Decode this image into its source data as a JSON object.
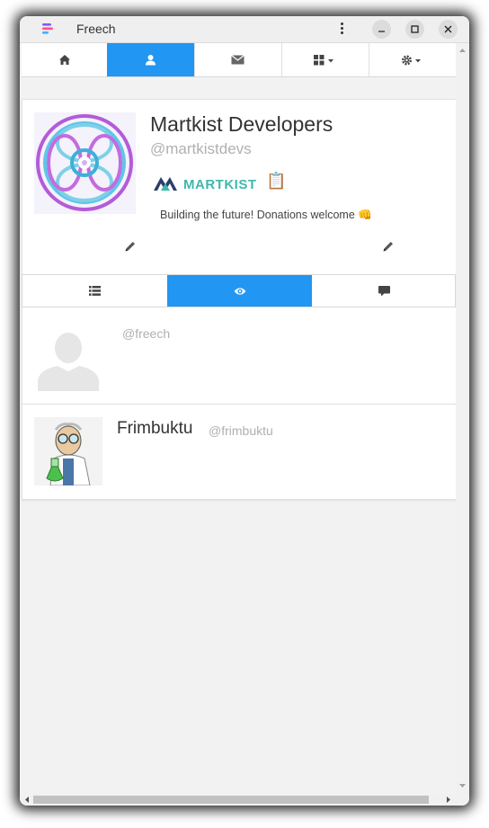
{
  "window": {
    "title": "Freech",
    "app_icon": "freech-logo-icon"
  },
  "navbar": {
    "tabs": [
      {
        "icon": "home-icon",
        "active": false
      },
      {
        "icon": "user-icon",
        "active": true
      },
      {
        "icon": "envelope-icon",
        "active": false
      },
      {
        "icon": "grid-dropdown-icon",
        "active": false
      },
      {
        "icon": "gear-dropdown-icon",
        "active": false
      }
    ]
  },
  "profile": {
    "name": "Martkist Developers",
    "handle": "@martkistdevs",
    "brand_text": "MARTKIST",
    "clipboard_glyph": "📋",
    "bio": "Building the future! Donations welcome 👊"
  },
  "profile_tabs": [
    {
      "icon": "list-icon",
      "active": false
    },
    {
      "icon": "eye-icon",
      "active": true
    },
    {
      "icon": "comment-icon",
      "active": false
    }
  ],
  "following": [
    {
      "name": "",
      "handle": "@freech",
      "avatar": "default-avatar"
    },
    {
      "name": "Frimbuktu",
      "handle": "@frimbuktu",
      "avatar": "scientist-avatar"
    }
  ],
  "colors": {
    "accent": "#2196f3",
    "brand_teal": "#3fb7ad",
    "brand_navy": "#2c3e6b"
  }
}
